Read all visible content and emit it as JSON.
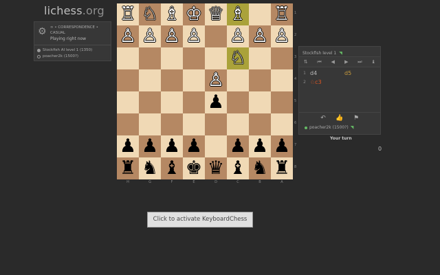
{
  "site": {
    "name": "lichess",
    "tld": ".org"
  },
  "game_info": {
    "meta_line1": "∞ • CORRESPONDENCE •",
    "meta_line2": "CASUAL",
    "status": "Playing right now",
    "players": [
      {
        "name": "Stockfish AI level 1 (1350)",
        "color": "white"
      },
      {
        "name": "poacher2k (1500?)",
        "color": "black"
      }
    ]
  },
  "board": {
    "orientation": "black",
    "highlight_squares": [
      "c3",
      "c1"
    ],
    "rows": [
      [
        "♖",
        "♘",
        "♗",
        "♔",
        "♕",
        "♗",
        "",
        "♖"
      ],
      [
        "♙",
        "♙",
        "♙",
        "♙",
        "",
        "♙",
        "♙",
        "♙"
      ],
      [
        "",
        "",
        "",
        "",
        "",
        "♘",
        "",
        ""
      ],
      [
        "",
        "",
        "",
        "",
        "♙",
        "",
        "",
        ""
      ],
      [
        "",
        "",
        "",
        "",
        "♟",
        "",
        "",
        ""
      ],
      [
        "",
        "",
        "",
        "",
        "",
        "",
        "",
        ""
      ],
      [
        "♟",
        "♟",
        "♟",
        "♟",
        "",
        "♟",
        "♟",
        "♟"
      ],
      [
        "♜",
        "♞",
        "♝",
        "♚",
        "♛",
        "♝",
        "♞",
        "♜"
      ]
    ],
    "piece_colors": [
      [
        "w",
        "w",
        "w",
        "w",
        "w",
        "w",
        "",
        "w"
      ],
      [
        "w",
        "w",
        "w",
        "w",
        "",
        "w",
        "w",
        "w"
      ],
      [
        "",
        "",
        "",
        "",
        "",
        "w",
        "",
        ""
      ],
      [
        "",
        "",
        "",
        "",
        "w",
        "",
        "",
        ""
      ],
      [
        "",
        "",
        "",
        "",
        "b",
        "",
        "",
        ""
      ],
      [
        "",
        "",
        "",
        "",
        "",
        "",
        "",
        ""
      ],
      [
        "b",
        "b",
        "b",
        "b",
        "",
        "b",
        "b",
        "b"
      ],
      [
        "b",
        "b",
        "b",
        "b",
        "b",
        "b",
        "b",
        "b"
      ]
    ],
    "rank_labels": [
      "1",
      "2",
      "3",
      "4",
      "5",
      "6",
      "7",
      "8"
    ],
    "file_labels": [
      "H",
      "G",
      "F",
      "E",
      "D",
      "C",
      "B",
      "A"
    ]
  },
  "table": {
    "opponent": "Stockfish level 1",
    "controls": [
      "⇅",
      "⏮",
      "◀",
      "▶",
      "⏭",
      "♝"
    ],
    "moves": [
      {
        "num": "1",
        "white": "d4",
        "black": "d5",
        "active": false
      },
      {
        "num": "2",
        "white": "♘c3",
        "black": "",
        "active": true
      }
    ],
    "actions": [
      "↶",
      "👍",
      "⚑"
    ],
    "me": "poacher2k (1500?)"
  },
  "your_turn": "Your turn",
  "clock": "0",
  "keyboard_button": "Click to activate KeyboardChess"
}
